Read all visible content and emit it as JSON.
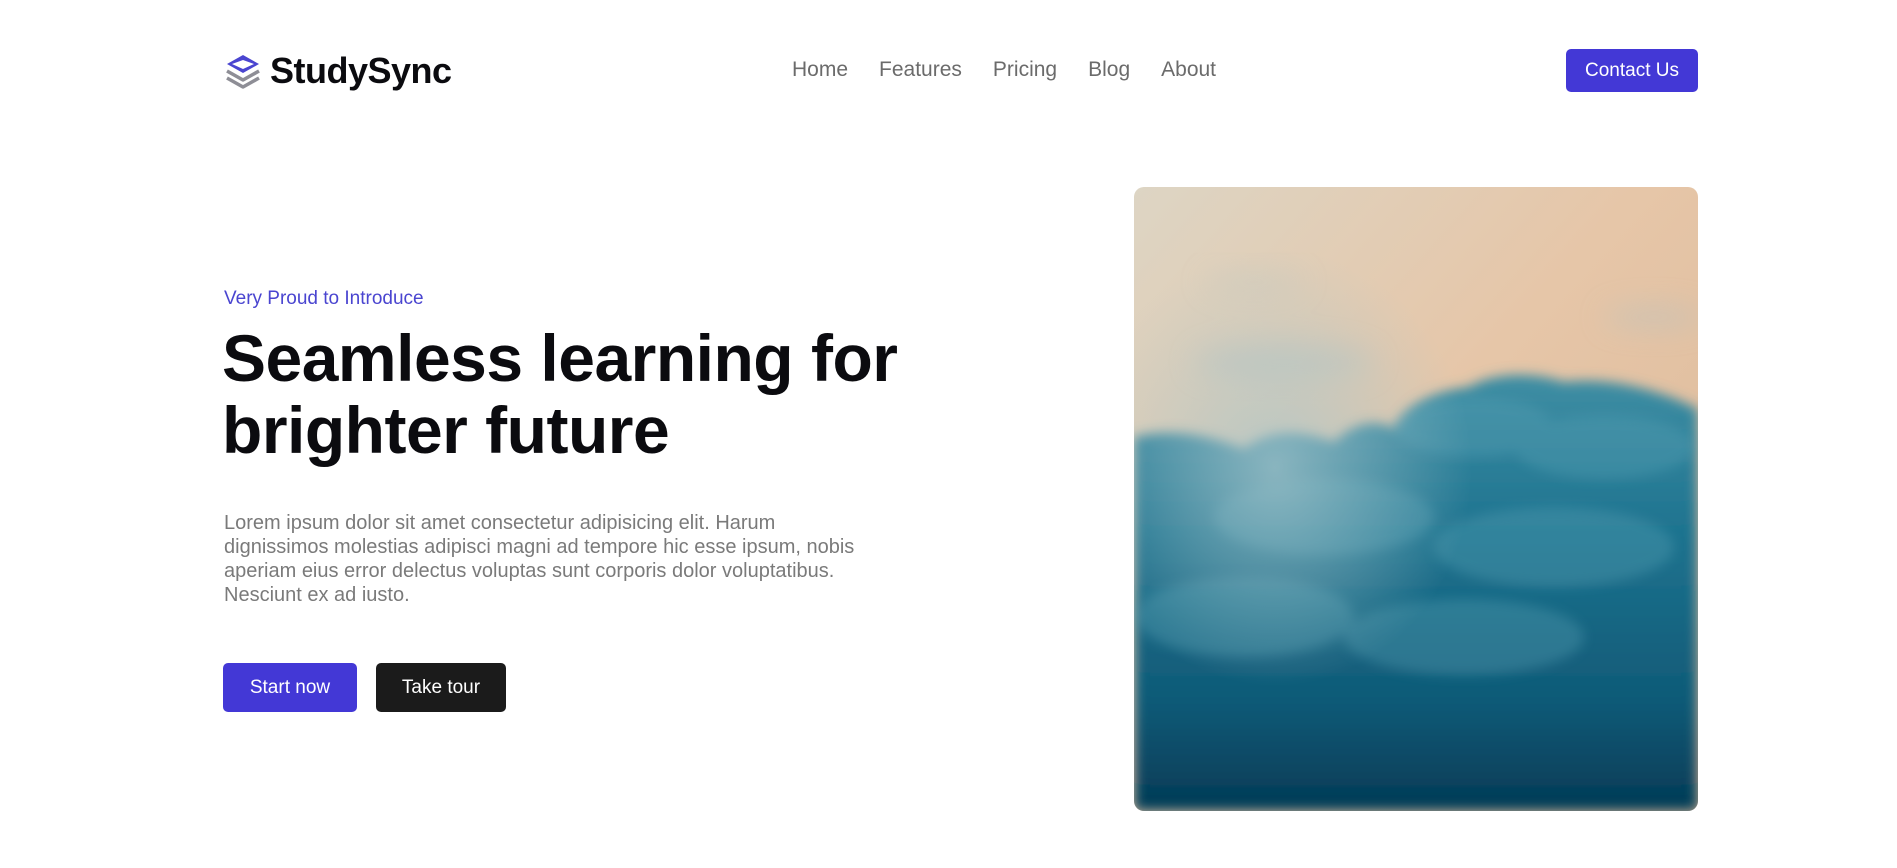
{
  "brand": {
    "name": "StudySync",
    "accent_color": "#4338d6",
    "logo_icon": "layers-icon"
  },
  "nav": {
    "items": [
      {
        "label": "Home"
      },
      {
        "label": "Features"
      },
      {
        "label": "Pricing"
      },
      {
        "label": "Blog"
      },
      {
        "label": "About"
      }
    ],
    "cta_label": "Contact Us"
  },
  "hero": {
    "eyebrow": "Very Proud to Introduce",
    "title": "Seamless learning for brighter future",
    "description": "Lorem ipsum dolor sit amet consectetur adipisicing elit. Harum dignissimos molestias adipisci magni ad tempore hic esse ipsum, nobis aperiam eius error delectus voluptas sunt corporis dolor voluptatibus. Nesciunt ex ad iusto.",
    "primary_button": "Start now",
    "secondary_button": "Take tour",
    "image_subject": "teal clouds under a peach sky"
  }
}
